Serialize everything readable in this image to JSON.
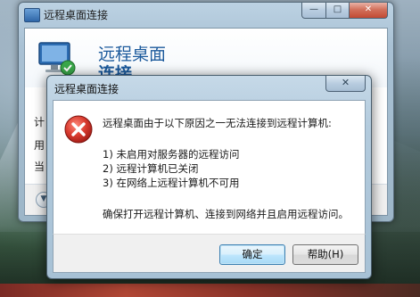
{
  "back_window": {
    "title": "远程桌面连接",
    "header_line1": "远程桌面",
    "header_line2": "连接",
    "labels": [
      "计",
      "用",
      "当"
    ],
    "controls": {
      "minimize": "—",
      "maximize": "□",
      "close": "✕"
    }
  },
  "dialog": {
    "title": "远程桌面连接",
    "close": "✕",
    "message": {
      "heading": "远程桌面由于以下原因之一无法连接到远程计算机:",
      "reasons": [
        "1) 未启用对服务器的远程访问",
        "2) 远程计算机已关闭",
        "3) 在网络上远程计算机不可用"
      ],
      "footer": "确保打开远程计算机、连接到网络并且启用远程访问。"
    },
    "buttons": {
      "ok": "确定",
      "help": "帮助(H)"
    },
    "icon": "error-icon"
  },
  "colors": {
    "accent": "#1c5a9c",
    "error_red": "#d83a2e",
    "window_frame": "#a9c1d4"
  }
}
